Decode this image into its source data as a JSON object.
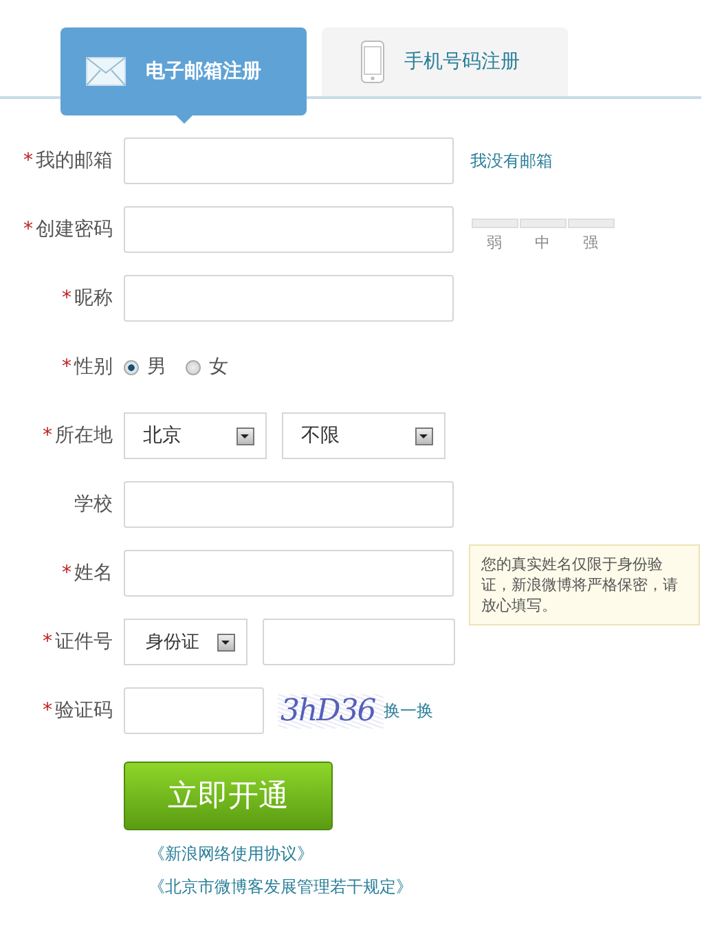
{
  "tabs": [
    {
      "label": "电子邮箱注册",
      "kind": "envelope",
      "selected": true
    },
    {
      "label": "手机号码注册",
      "kind": "phone",
      "selected": false
    }
  ],
  "rows": [
    {
      "kind": "text",
      "mark": "*",
      "label": "我的邮箱",
      "link": "我没有邮箱"
    },
    {
      "kind": "password",
      "mark": "*",
      "label": "创建密码",
      "strength": [
        "弱",
        "中",
        "强"
      ]
    },
    {
      "kind": "text",
      "mark": "*",
      "label": "昵称"
    },
    {
      "kind": "radio",
      "mark": "*",
      "label": "性别",
      "options": [
        {
          "label": "男",
          "selected": true
        },
        {
          "label": "女",
          "selected": false
        }
      ]
    },
    {
      "kind": "select",
      "mark": "*",
      "label": "所在地",
      "selects": [
        "北京",
        "不限"
      ]
    },
    {
      "kind": "text",
      "label": "学校"
    },
    {
      "kind": "text",
      "mark": "*",
      "label": "姓名",
      "tip": "您的真实姓名仅限于身份验证，新浪微博将严格保密，请放心填写。"
    },
    {
      "kind": "id",
      "mark": "*",
      "label": "证件号",
      "selects": [
        "身份证"
      ]
    },
    {
      "kind": "captcha",
      "mark": "*",
      "label": "验证码",
      "captcha": "3hD36",
      "link": "换一换"
    }
  ],
  "submit": "立即开通",
  "agreements": [
    "《新浪网络使用协议》",
    "《北京市微博客发展管理若干规定》"
  ]
}
